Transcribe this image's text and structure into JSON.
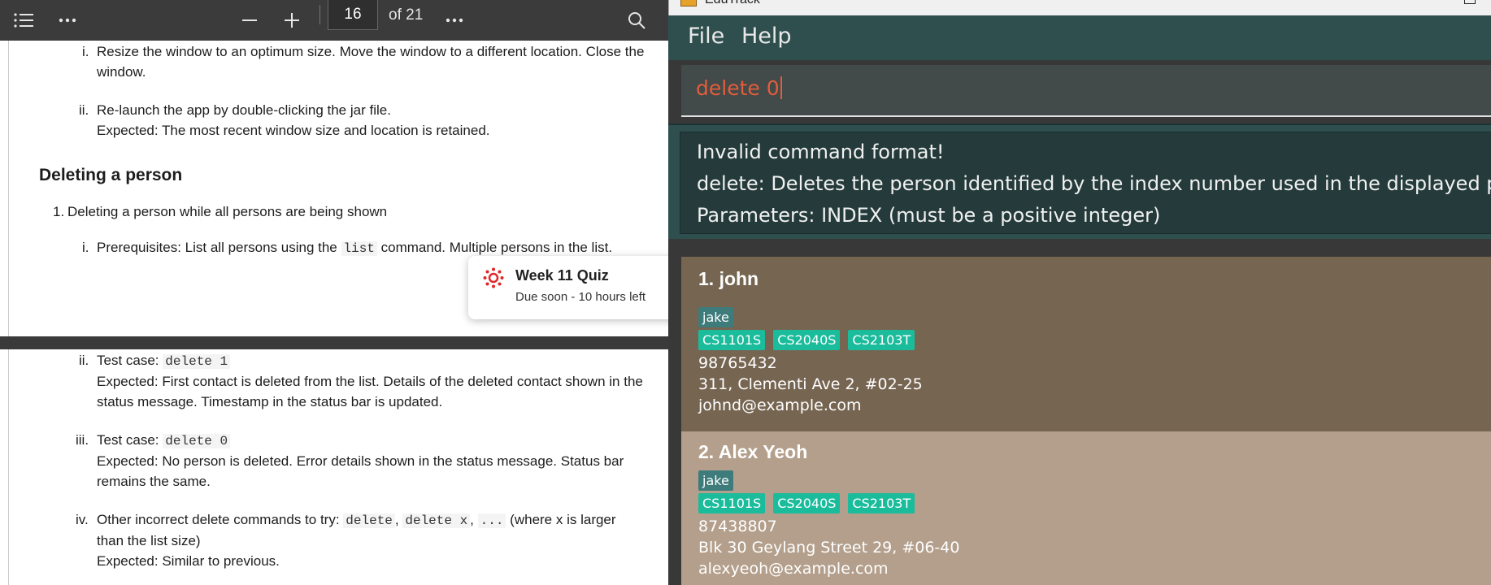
{
  "pdf_viewer": {
    "toolbar": {
      "page_current": "16",
      "page_total": "of 21",
      "icons": [
        "contents-icon",
        "more-icon",
        "zoom-out-icon",
        "zoom-in-icon",
        "more-icon",
        "search-icon"
      ]
    },
    "page1": {
      "item_i": [
        "Resize the window to an optimum size. Move the window to a different location. Close the",
        "window."
      ],
      "item_ii": [
        "Re-launch the app by double-clicking the jar file.",
        "Expected: The most recent window size and location is retained."
      ],
      "heading": "Deleting a person",
      "list_1": "Deleting a person while all persons are being shown",
      "prereq_a": "Prerequisites: List all persons using the",
      "prereq_code": "list",
      "prereq_b": "command. Multiple persons in the list.",
      "markers": {
        "i": "i.",
        "ii": "ii.",
        "one": "1."
      }
    },
    "toast": {
      "title": "Week 11 Quiz",
      "subtitle": "Due soon - 10 hours left"
    },
    "page2": {
      "ii_label": "Test case:",
      "ii_code": "delete 1",
      "ii_exp": [
        "Expected: First contact is deleted from the list. Details of the deleted contact shown in the",
        "status message. Timestamp in the status bar is updated."
      ],
      "iii_label": "Test case:",
      "iii_code": "delete 0",
      "iii_exp": [
        "Expected: No person is deleted. Error details shown in the status message. Status bar",
        "remains the same."
      ],
      "iv_a": "Other incorrect delete commands to try:",
      "iv_code1": "delete",
      "iv_code2": "delete x",
      "iv_code3": "...",
      "iv_b": "(where x is larger",
      "iv_c": "than the list size)",
      "iv_exp": "Expected: Similar to previous.",
      "markers": {
        "ii": "ii.",
        "iii": "iii.",
        "iv": "iv."
      }
    }
  },
  "app": {
    "title": "EduTrack",
    "menu": [
      "File",
      "Help"
    ],
    "command_input": "delete 0",
    "result": [
      "Invalid command format!",
      "delete: Deletes the person identified by the index number used in the displayed person list.",
      "Parameters: INDEX (must be a positive integer)"
    ],
    "persons": [
      {
        "name": "1. john",
        "name_tag": "jake",
        "modules": [
          "CS1101S",
          "CS2040S",
          "CS2103T"
        ],
        "phone": "98765432",
        "address": "311, Clementi Ave 2, #02-25",
        "email": "johnd@example.com"
      },
      {
        "name": "2. Alex Yeoh",
        "name_tag": "jake",
        "modules": [
          "CS1101S",
          "CS2040S",
          "CS2103T"
        ],
        "phone": "87438807",
        "address": "Blk 30 Geylang Street 29, #06-40",
        "email": "alexyeoh@example.com"
      }
    ],
    "colors": {
      "card1": "#766551",
      "card2": "#b39f8b",
      "menubar": "#2f4f4f",
      "command_text": "#e35d3b",
      "tag_module": "#1abc9c",
      "tag_name": "#3e7b7b"
    }
  }
}
